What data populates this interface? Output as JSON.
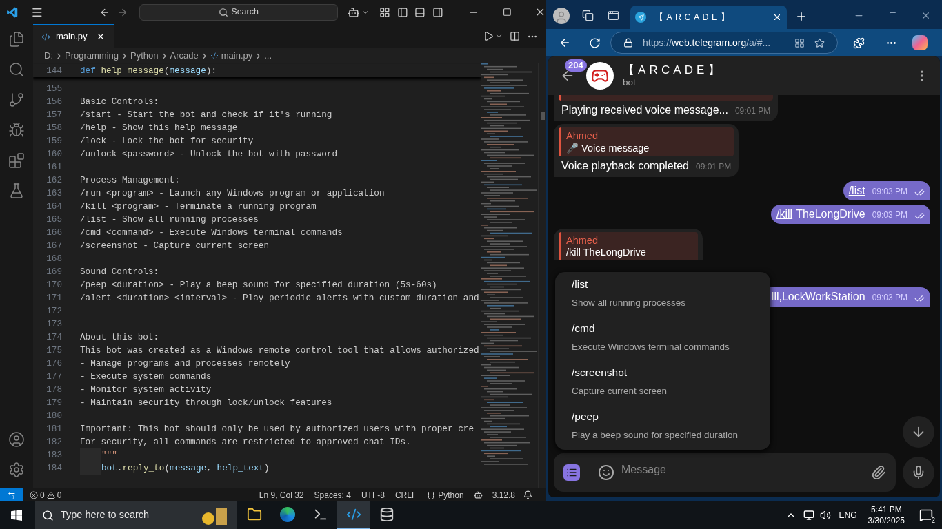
{
  "vscode": {
    "search": "Search",
    "tab": {
      "label": "main.py",
      "selected": true
    },
    "breadcrumbs": [
      "D:",
      "Programming",
      "Python",
      "Arcade",
      "main.py",
      "..."
    ],
    "activity": [
      {
        "kind": "files",
        "selected": false
      },
      {
        "kind": "search",
        "selected": false
      },
      {
        "kind": "git",
        "selected": false
      },
      {
        "kind": "debug",
        "selected": false
      },
      {
        "kind": "extensions",
        "selected": false
      },
      {
        "kind": "testing",
        "selected": false
      }
    ],
    "sticky": {
      "n": "144",
      "segs": [
        {
          "t": "def ",
          "kind": "kw"
        },
        {
          "t": "help_message",
          "kind": "fn"
        },
        {
          "t": "(",
          "kind": "p"
        },
        {
          "t": "message",
          "kind": "var"
        },
        {
          "t": "):",
          "kind": "p"
        }
      ]
    },
    "lines": [
      {
        "n": "155",
        "kind": "doc"
      },
      {
        "n": "156",
        "kind": "doc",
        "segs": [
          {
            "t": "Basic Controls:",
            "kind": "doc"
          }
        ]
      },
      {
        "n": "157",
        "kind": "doc",
        "segs": [
          {
            "t": "/start - Start the bot and check if it's running",
            "kind": "doc"
          }
        ]
      },
      {
        "n": "158",
        "kind": "doc",
        "segs": [
          {
            "t": "/help - Show this help message",
            "kind": "doc"
          }
        ]
      },
      {
        "n": "159",
        "kind": "doc",
        "segs": [
          {
            "t": "/lock - Lock the bot for security",
            "kind": "doc"
          }
        ]
      },
      {
        "n": "160",
        "kind": "doc",
        "segs": [
          {
            "t": "/unlock <password> - Unlock the bot with password",
            "kind": "doc"
          }
        ]
      },
      {
        "n": "161",
        "kind": "doc"
      },
      {
        "n": "162",
        "kind": "doc",
        "segs": [
          {
            "t": "Process Management:",
            "kind": "doc"
          }
        ]
      },
      {
        "n": "163",
        "kind": "doc",
        "segs": [
          {
            "t": "/run <program> - Launch any Windows program or application",
            "kind": "doc"
          }
        ]
      },
      {
        "n": "164",
        "kind": "doc",
        "segs": [
          {
            "t": "/kill <program> - Terminate a running program",
            "kind": "doc"
          }
        ]
      },
      {
        "n": "165",
        "kind": "doc",
        "segs": [
          {
            "t": "/list - Show all running processes",
            "kind": "doc"
          }
        ]
      },
      {
        "n": "166",
        "kind": "doc",
        "segs": [
          {
            "t": "/cmd <command> - Execute Windows terminal commands",
            "kind": "doc"
          }
        ]
      },
      {
        "n": "167",
        "kind": "doc",
        "segs": [
          {
            "t": "/screenshot - Capture current screen",
            "kind": "doc"
          }
        ]
      },
      {
        "n": "168",
        "kind": "doc"
      },
      {
        "n": "169",
        "kind": "doc",
        "segs": [
          {
            "t": "Sound Controls:",
            "kind": "doc"
          }
        ]
      },
      {
        "n": "170",
        "kind": "doc",
        "segs": [
          {
            "t": "/peep <duration> - Play a beep sound for specified duration (5s-60s)",
            "kind": "doc"
          }
        ]
      },
      {
        "n": "171",
        "kind": "doc",
        "segs": [
          {
            "t": "/alert <duration> <interval> - Play periodic alerts with custom duration and",
            "kind": "doc"
          }
        ]
      },
      {
        "n": "172",
        "kind": "doc"
      },
      {
        "n": "173",
        "kind": "doc"
      },
      {
        "n": "174",
        "kind": "doc",
        "segs": [
          {
            "t": "About this bot:",
            "kind": "doc"
          }
        ]
      },
      {
        "n": "175",
        "kind": "doc",
        "segs": [
          {
            "t": "This bot was created as a Windows remote control tool that allows authorized",
            "kind": "doc"
          }
        ]
      },
      {
        "n": "176",
        "kind": "doc",
        "segs": [
          {
            "t": "- Manage programs and processes remotely",
            "kind": "doc"
          }
        ]
      },
      {
        "n": "177",
        "kind": "doc",
        "segs": [
          {
            "t": "- Execute system commands",
            "kind": "doc"
          }
        ]
      },
      {
        "n": "178",
        "kind": "doc",
        "segs": [
          {
            "t": "- Monitor system activity",
            "kind": "doc"
          }
        ]
      },
      {
        "n": "179",
        "kind": "doc",
        "segs": [
          {
            "t": "- Maintain security through lock/unlock features",
            "kind": "doc"
          }
        ]
      },
      {
        "n": "180",
        "kind": "doc"
      },
      {
        "n": "181",
        "kind": "doc",
        "segs": [
          {
            "t": "Important: This bot should only be used by authorized users with proper cre",
            "kind": "doc"
          }
        ]
      },
      {
        "n": "182",
        "kind": "doc",
        "segs": [
          {
            "t": "For security, all commands are restricted to approved chat IDs.",
            "kind": "doc"
          }
        ]
      },
      {
        "n": "183",
        "kind": "py",
        "segs": [
          {
            "t": "\"\"\"",
            "kind": "str"
          }
        ]
      },
      {
        "n": "184",
        "kind": "py",
        "segs": [
          {
            "t": "bot",
            "kind": "var"
          },
          {
            "t": ".",
            "kind": "p"
          },
          {
            "t": "reply_to",
            "kind": "fn"
          },
          {
            "t": "(",
            "kind": "p"
          },
          {
            "t": "message",
            "kind": "var"
          },
          {
            "t": ", ",
            "kind": "p"
          },
          {
            "t": "help_text",
            "kind": "var"
          },
          {
            "t": ")",
            "kind": "p"
          }
        ]
      }
    ],
    "status": {
      "errors": "0",
      "warnings": "0",
      "items": [
        "Ln 9, Col 32",
        "Spaces: 4",
        "UTF-8",
        "CRLF"
      ],
      "language": "Python",
      "version": "3.12.8"
    }
  },
  "browser": {
    "tab": {
      "title": "【ARCADE】",
      "selected": true
    },
    "url": [
      {
        "t": "https://",
        "bright": false
      },
      {
        "t": "web.telegram.org",
        "bright": true
      },
      {
        "t": "/a/#...",
        "bright": false
      }
    ],
    "chat": {
      "badge": "204",
      "title": "【ARCADE】",
      "subtitle": "bot",
      "messages": [
        {
          "kind": "in_cut",
          "text": "Playing received voice message...",
          "time": "09:01 PM"
        },
        {
          "kind": "in",
          "reply_sender": "Ahmed",
          "reply_text": "🎤 Voice message",
          "text": "Voice playback completed",
          "time": "09:01 PM"
        },
        {
          "kind": "out",
          "link": "/list",
          "time": "09:03 PM",
          "read": true
        },
        {
          "kind": "out",
          "link": "/kill",
          "text": "TheLongDrive",
          "time": "09:03 PM",
          "read": true
        },
        {
          "kind": "quote",
          "reply_sender": "Ahmed",
          "reply_text": "/kill TheLongDrive"
        },
        {
          "kind": "out",
          "text": "lll,LockWorkStation",
          "time": "09:03 PM",
          "read": true,
          "covered": true
        }
      ],
      "commands": [
        {
          "name": "/list",
          "desc": "Show all running processes"
        },
        {
          "name": "/cmd",
          "desc": "Execute Windows terminal commands"
        },
        {
          "name": "/screenshot",
          "desc": "Capture current screen"
        },
        {
          "name": "/peep",
          "desc": "Play a beep sound for specified duration"
        }
      ],
      "placeholder": "Message"
    }
  },
  "taskbar": {
    "search": "Type here to search",
    "apps": [
      {
        "kind": "folder",
        "selected": false
      },
      {
        "kind": "edge",
        "selected": false
      },
      {
        "kind": "terminal",
        "selected": false
      },
      {
        "kind": "vscode",
        "selected": true
      },
      {
        "kind": "database",
        "selected": false
      }
    ],
    "lang": "ENG",
    "time": "5:41 PM",
    "date": "3/30/2025",
    "notifications": "2"
  }
}
